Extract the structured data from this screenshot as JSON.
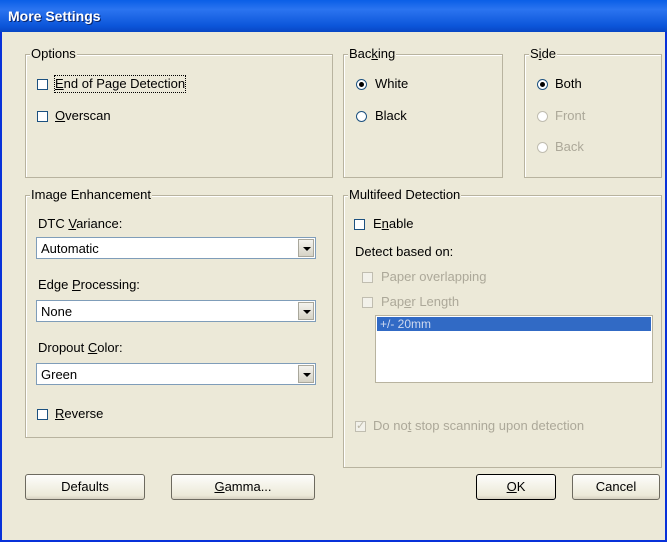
{
  "window": {
    "title": "More Settings"
  },
  "options": {
    "legend": "Options",
    "end_of_page": {
      "prefix": "",
      "accel": "E",
      "rest": "nd of Page Detection",
      "checked": false
    },
    "overscan": {
      "prefix": "",
      "accel": "O",
      "rest": "verscan",
      "checked": false
    }
  },
  "backing": {
    "legend_prefix": "Bac",
    "legend_accel": "k",
    "legend_rest": "ing",
    "options": [
      {
        "label": "White",
        "selected": true
      },
      {
        "label": "Black",
        "selected": false
      }
    ]
  },
  "side": {
    "legend_prefix": "S",
    "legend_accel": "i",
    "legend_rest": "de",
    "options": [
      {
        "label": "Both",
        "selected": true,
        "enabled": true
      },
      {
        "label": "Front",
        "selected": false,
        "enabled": false
      },
      {
        "label": "Back",
        "selected": false,
        "enabled": false
      }
    ]
  },
  "image_enhancement": {
    "legend": "Image Enhancement",
    "dtc": {
      "label_prefix": "DTC ",
      "label_accel": "V",
      "label_rest": "ariance:",
      "value": "Automatic"
    },
    "edge": {
      "label_prefix": "Edge ",
      "label_accel": "P",
      "label_rest": "rocessing:",
      "value": "None"
    },
    "dropout": {
      "label_prefix": "Dropout ",
      "label_accel": "C",
      "label_rest": "olor:",
      "value": "Green"
    },
    "reverse": {
      "label_prefix": "",
      "label_accel": "R",
      "label_rest": "everse",
      "checked": false
    }
  },
  "multifeed": {
    "legend": "Multifeed Detection",
    "enable": {
      "label_prefix": "E",
      "label_accel": "n",
      "label_rest": "able",
      "checked": false
    },
    "detect_label": "Detect based on:",
    "paper_overlapping": {
      "label_prefix": "Paper overlappin",
      "label_accel": "g",
      "label_rest": "",
      "checked": false
    },
    "paper_length": {
      "label_prefix": "Pap",
      "label_accel": "e",
      "label_rest": "r Length",
      "checked": false
    },
    "length_items": [
      "+/- 20mm"
    ],
    "do_not_stop": {
      "label_prefix": "Do no",
      "label_accel": "t",
      "label_rest": " stop scanning upon detection",
      "checked": true
    }
  },
  "buttons": {
    "defaults": "Defaults",
    "gamma_accel": "G",
    "gamma_rest": "amma...",
    "ok_accel": "O",
    "ok_rest": "K",
    "cancel": "Cancel"
  },
  "colors": {
    "title_bar": "#0a5fe6",
    "face": "#ece9d8",
    "selection": "#316ac5"
  }
}
